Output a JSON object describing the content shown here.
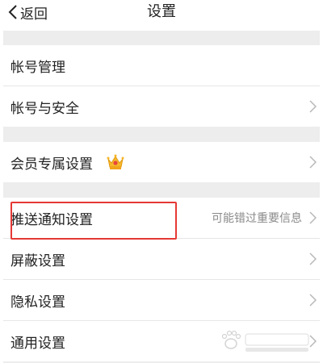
{
  "header": {
    "back_label": "返回",
    "title": "设置"
  },
  "rows": [
    {
      "label": "帐号管理"
    },
    {
      "label": "帐号与安全"
    },
    {
      "label": "会员专属设置"
    },
    {
      "label": "推送通知设置",
      "hint": "可能错过重要信息"
    },
    {
      "label": "屏蔽设置"
    },
    {
      "label": "隐私设置"
    },
    {
      "label": "通用设置"
    }
  ],
  "icons": {
    "back": "chevron-left-icon",
    "chevron": "chevron-right-icon",
    "vip": "crown-icon"
  },
  "colors": {
    "background": "#ededed",
    "row": "#ffffff",
    "highlight": "#e53935",
    "hint": "#8a8a8a",
    "chevron": "#b8b8b8"
  }
}
